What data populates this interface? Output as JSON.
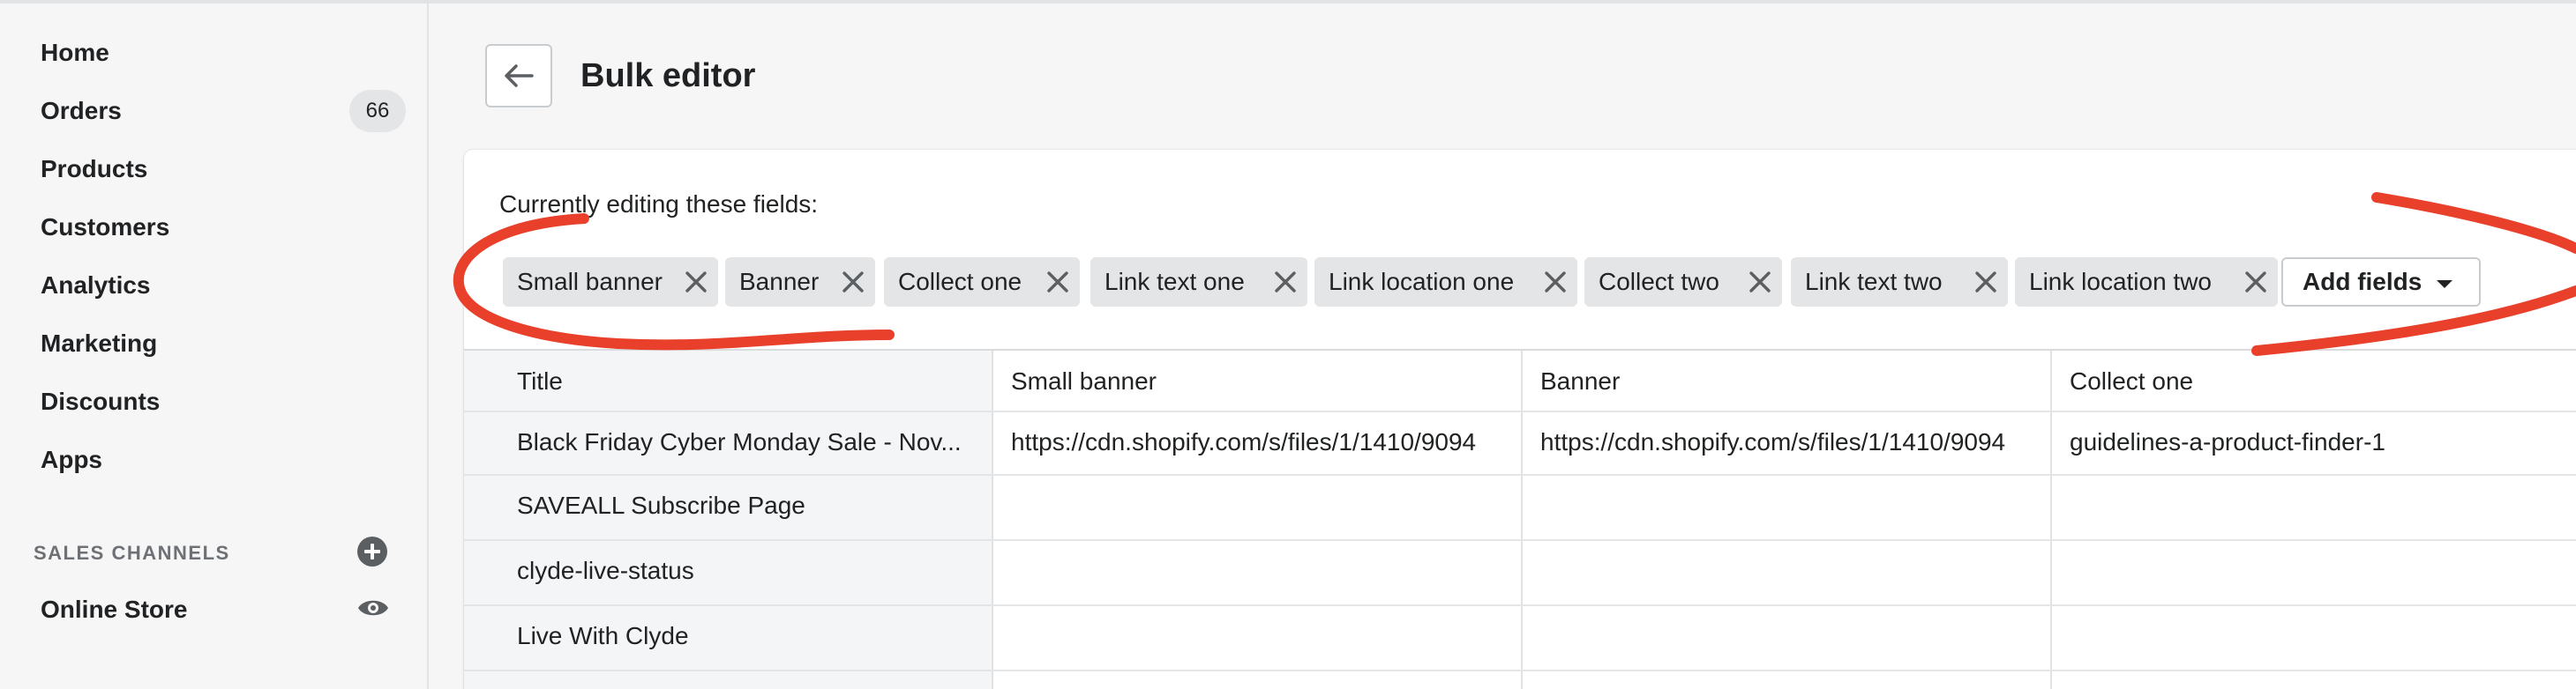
{
  "sidebar": {
    "items": [
      {
        "label": "Home"
      },
      {
        "label": "Orders",
        "badge": "66"
      },
      {
        "label": "Products"
      },
      {
        "label": "Customers"
      },
      {
        "label": "Analytics"
      },
      {
        "label": "Marketing"
      },
      {
        "label": "Discounts"
      },
      {
        "label": "Apps"
      }
    ],
    "sales_channels_title": "SALES CHANNELS",
    "add_channel_icon": "plus-circle-icon",
    "online_store": {
      "label": "Online Store",
      "icon": "eye-icon"
    }
  },
  "header": {
    "back_icon": "arrow-left-icon",
    "title": "Bulk editor"
  },
  "editor": {
    "editing_label": "Currently editing these fields:",
    "fields": [
      "Small banner",
      "Banner",
      "Collect one",
      "Link text one",
      "Link location one",
      "Collect two",
      "Link text two",
      "Link location two"
    ],
    "add_fields_label": "Add fields"
  },
  "table": {
    "columns": [
      "Title",
      "Small banner",
      "Banner",
      "Collect one"
    ],
    "rows": [
      [
        "Black Friday Cyber Monday Sale - Nov...",
        "https://cdn.shopify.com/s/files/1/1410/9094",
        "https://cdn.shopify.com/s/files/1/1410/9094",
        "guidelines-a-product-finder-1"
      ],
      [
        "SAVEALL Subscribe Page",
        "",
        "",
        ""
      ],
      [
        "clyde-live-status",
        "",
        "",
        ""
      ],
      [
        "Live With Clyde",
        "",
        "",
        ""
      ]
    ]
  },
  "colors": {
    "annotation": "#e8402a",
    "chip_bg": "#e4e5e7",
    "page_bg": "#f6f6f7"
  }
}
